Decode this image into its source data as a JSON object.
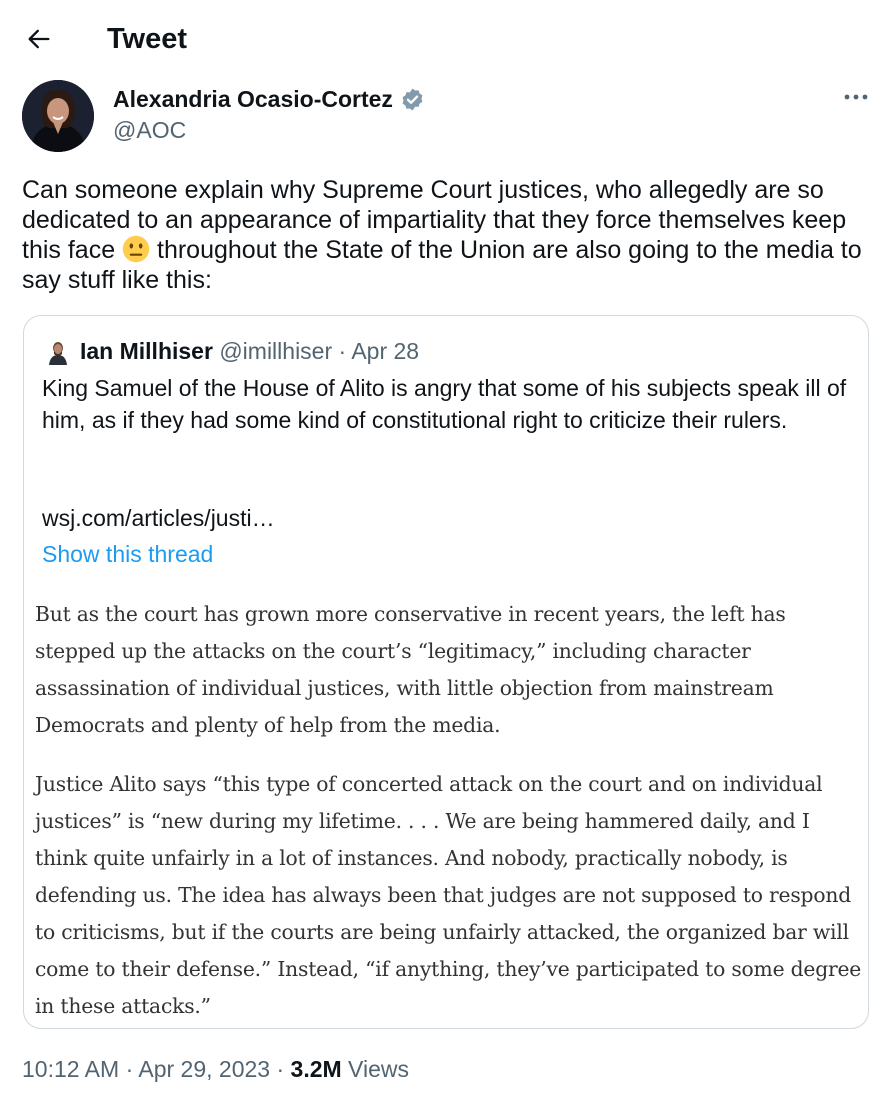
{
  "header": {
    "title": "Tweet"
  },
  "author": {
    "name": "Alexandria Ocasio-Cortez",
    "handle": "@AOC"
  },
  "tweet": {
    "text_before_emoji": "Can someone explain why Supreme Court justices, who allegedly are so dedicated to an appearance of impartiality that they force themselves keep this face ",
    "emoji": "neutral-face-emoji",
    "text_after_emoji": " throughout the State of the Union are also going to the media to say stuff like this:"
  },
  "quote": {
    "name": "Ian Millhiser",
    "handle": "@imillhiser",
    "separator": " · ",
    "date": "Apr 28",
    "text": "King Samuel of the House of Alito is angry that some of his subjects speak ill of him, as if they had some kind of constitutional right to criticize their rulers.",
    "link": "wsj.com/articles/justi…",
    "show_thread": "Show this thread",
    "article_paragraphs": [
      "But as the court has grown more conservative in recent years, the left has stepped up the attacks on the court’s “legitimacy,” including character assassination of individual justices, with little objection from mainstream Democrats and plenty of help from the media.",
      "Justice Alito says “this type of concerted attack on the court and on individual justices” is “new during my lifetime. . . . We are being hammered daily, and I think quite unfairly in a lot of instances. And nobody, practically nobody, is defending us. The idea has always been that judges are not supposed to respond to criticisms, but if the courts are being unfairly attacked, the organized bar will come to their defense.” Instead, “if anything, they’ve participated to some degree in these attacks.”"
    ]
  },
  "footer": {
    "time": "10:12 AM",
    "separator": " · ",
    "date": "Apr 29, 2023",
    "views_count": "3.2M",
    "views_label": " Views"
  },
  "colors": {
    "text": "#0f1419",
    "secondary": "#536471",
    "link": "#1d9bf0",
    "border": "#cfd9de",
    "verified": "#829aab",
    "emoji": "#ffcc4d"
  },
  "icons": {
    "back": "arrow-left-icon",
    "verified": "verified-badge-icon",
    "more": "more-dots-icon"
  }
}
